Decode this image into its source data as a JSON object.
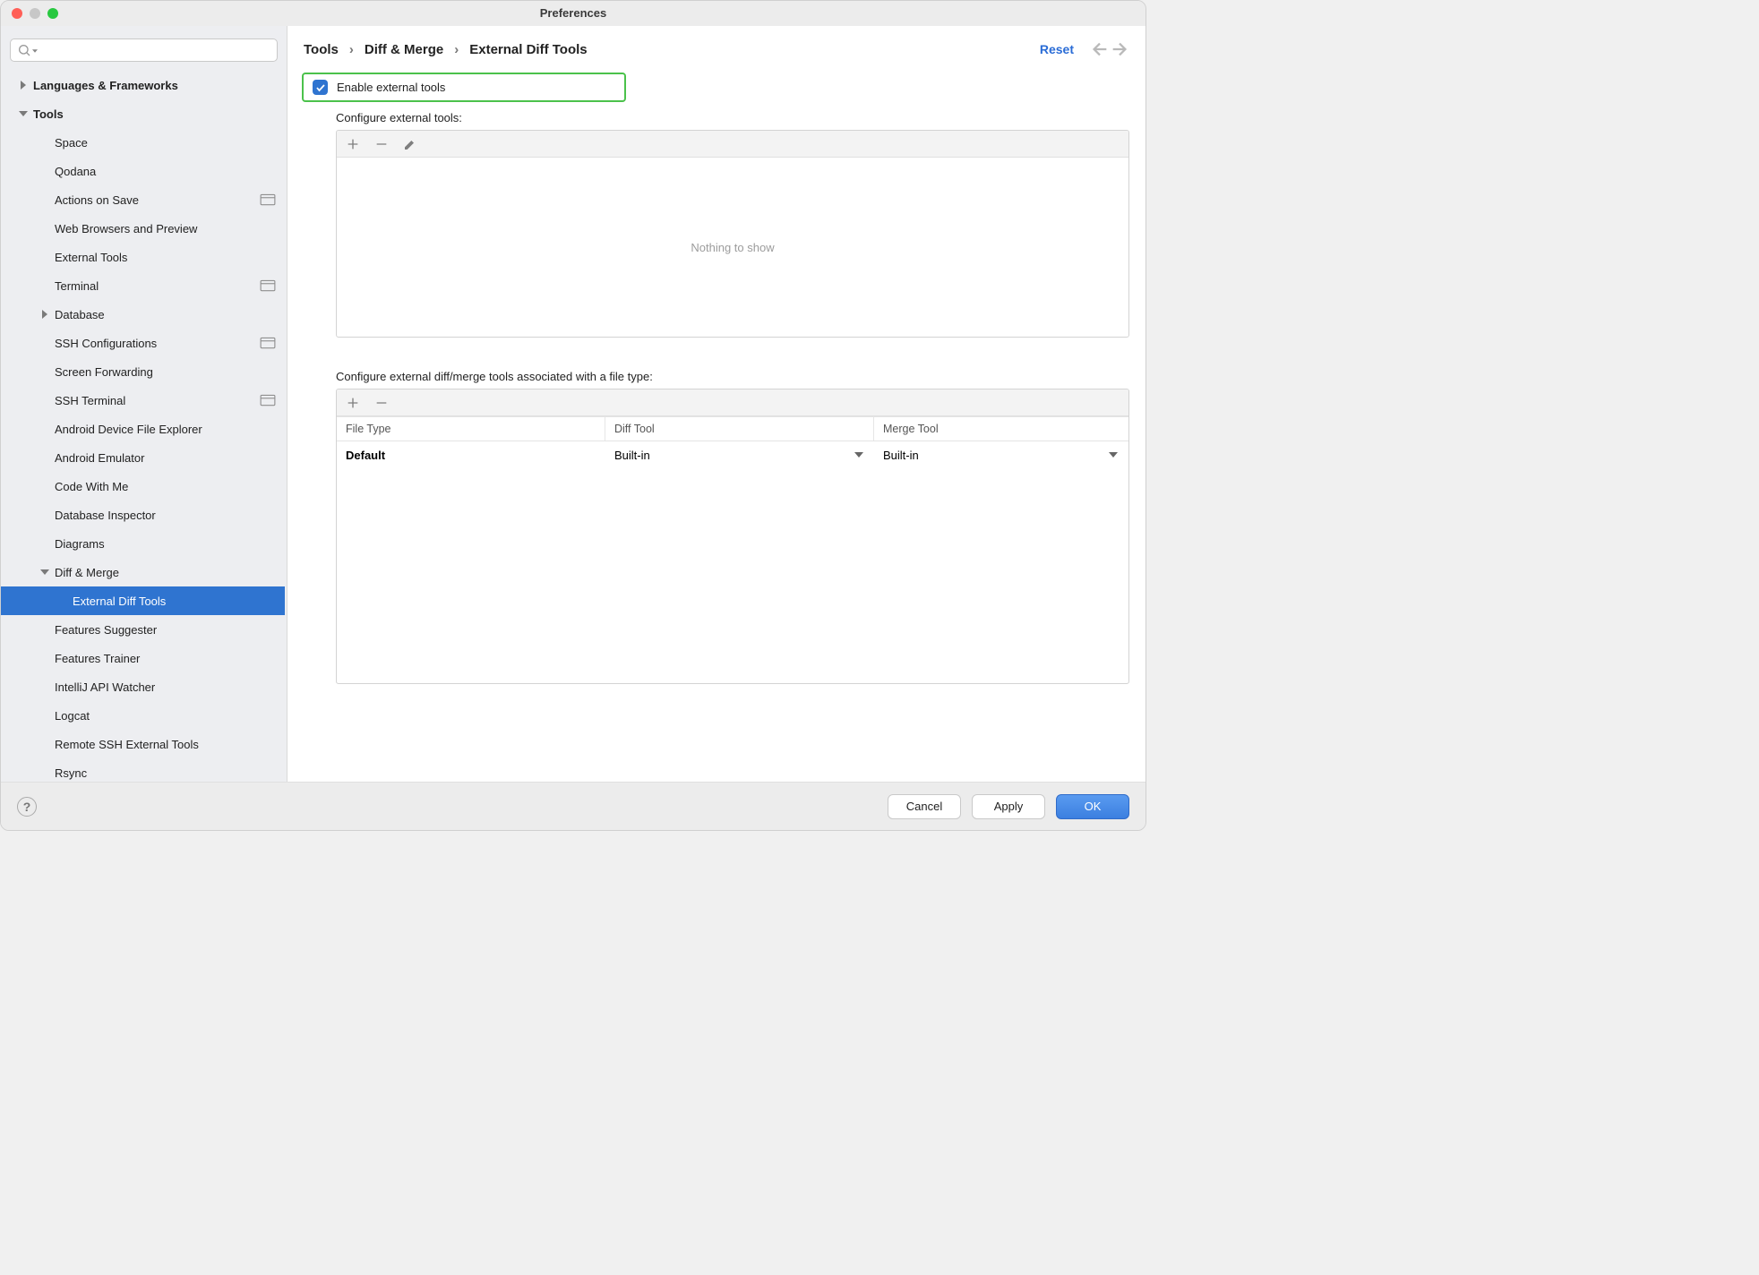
{
  "window": {
    "title": "Preferences"
  },
  "sidebar": {
    "search_placeholder": "",
    "cats": {
      "lang": "Languages & Frameworks",
      "tools": "Tools"
    },
    "tools": [
      "Space",
      "Qodana",
      "Actions on Save",
      "Web Browsers and Preview",
      "External Tools",
      "Terminal",
      "Database",
      "SSH Configurations",
      "Screen Forwarding",
      "SSH Terminal",
      "Android Device File Explorer",
      "Android Emulator",
      "Code With Me",
      "Database Inspector",
      "Diagrams",
      "Diff & Merge",
      "Features Suggester",
      "Features Trainer",
      "IntelliJ API Watcher",
      "Logcat",
      "Remote SSH External Tools",
      "Rsync"
    ],
    "diffmerge_children": [
      "External Diff Tools"
    ]
  },
  "breadcrumb": [
    "Tools",
    "Diff & Merge",
    "External Diff Tools"
  ],
  "header": {
    "reset": "Reset"
  },
  "content": {
    "enable_label": "Enable external tools",
    "configure_tools_label": "Configure external tools:",
    "empty_text": "Nothing to show",
    "configure_filetype_label": "Configure external diff/merge tools associated with a file type:",
    "table": {
      "headers": {
        "file_type": "File Type",
        "diff_tool": "Diff Tool",
        "merge_tool": "Merge Tool"
      },
      "rows": [
        {
          "file_type": "Default",
          "diff_tool": "Built-in",
          "merge_tool": "Built-in"
        }
      ]
    }
  },
  "footer": {
    "cancel": "Cancel",
    "apply": "Apply",
    "ok": "OK"
  }
}
